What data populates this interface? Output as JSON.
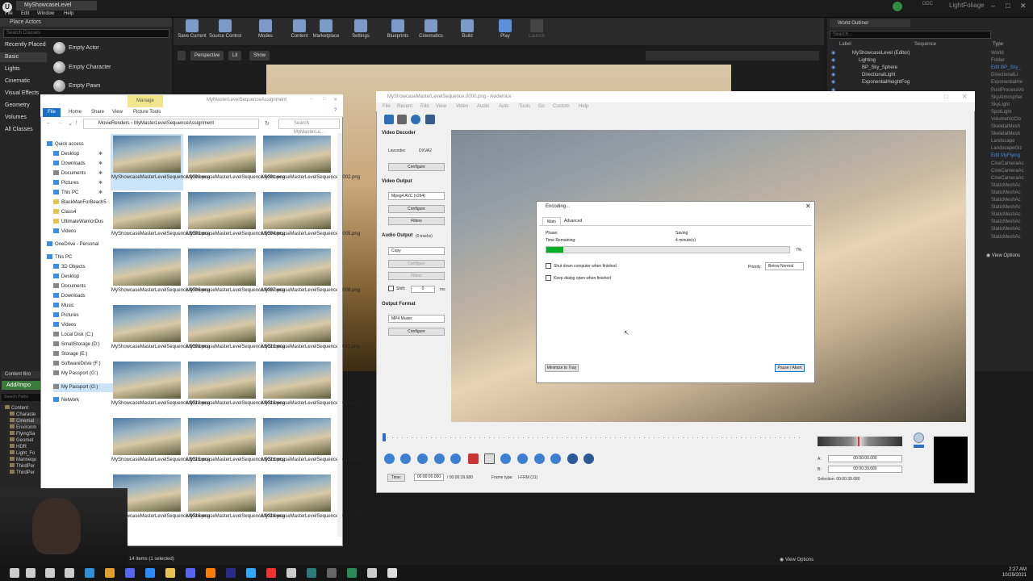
{
  "ue": {
    "tab_title": "MyShowcaseLevel",
    "menus": [
      "File",
      "Edit",
      "Window",
      "Help"
    ],
    "right_title": "LightFoliage",
    "ddc": "DDC",
    "place_actors": {
      "header": "Place Actors",
      "search_placeholder": "Search Classes",
      "categories": [
        "Recently Placed",
        "Basic",
        "Lights",
        "Cinematic",
        "Visual Effects",
        "Geometry",
        "Volumes",
        "All Classes"
      ],
      "active_category": "Basic",
      "items": [
        "Empty Actor",
        "Empty Character",
        "Empty Pawn"
      ]
    },
    "toolbar": [
      "Save Current",
      "Source Control",
      "Modes",
      "Content",
      "Marketplace",
      "Settings",
      "Blueprints",
      "Cinematics",
      "Build",
      "Play",
      "Launch"
    ],
    "viewport": {
      "perspective": "Perspective",
      "lit": "Lit",
      "show": "Show"
    },
    "outliner": {
      "tab": "World Outliner",
      "search_placeholder": "Search...",
      "col_label": "Label",
      "col_sequence": "Sequence",
      "col_type": "Type",
      "rows": [
        {
          "label": "MyShowcaseLevel (Editor)",
          "type": "World",
          "link": false
        },
        {
          "label": "Lighting",
          "type": "Folder",
          "link": false
        },
        {
          "label": "BP_Sky_Sphere",
          "type": "Edit BP_Sky_",
          "link": true
        },
        {
          "label": "DirectionalLight",
          "type": "DirectionalLi",
          "link": false
        },
        {
          "label": "ExponentialHeightFog",
          "type": "ExponentialHe",
          "link": false
        },
        {
          "label": "",
          "type": "PostProcessVo",
          "link": false
        },
        {
          "label": "",
          "type": "SkyAtmospher",
          "link": false
        },
        {
          "label": "",
          "type": "SkyLight",
          "link": false
        },
        {
          "label": "",
          "type": "SpotLight",
          "link": false
        },
        {
          "label": "",
          "type": "VolumetricClo",
          "link": false
        },
        {
          "label": "",
          "type": "SkeletalMesh",
          "link": false
        },
        {
          "label": "",
          "type": "SkeletalMesh",
          "link": false
        },
        {
          "label": "",
          "type": "Landscape",
          "link": false
        },
        {
          "label": "",
          "type": "LandscapeGiz",
          "link": false
        },
        {
          "label": "",
          "type": "Edit MyFlying",
          "link": true
        },
        {
          "label": "",
          "type": "CineCameraAc",
          "link": false
        },
        {
          "label": "",
          "type": "CineCameraAc",
          "link": false
        },
        {
          "label": "",
          "type": "CineCameraAc",
          "link": false
        },
        {
          "label": "",
          "type": "StaticMeshAc",
          "link": false
        },
        {
          "label": "",
          "type": "StaticMeshAc",
          "link": false
        },
        {
          "label": "",
          "type": "StaticMeshAc",
          "link": false
        },
        {
          "label": "",
          "type": "StaticMeshAc",
          "link": false
        },
        {
          "label": "",
          "type": "StaticMeshAc",
          "link": false
        },
        {
          "label": "",
          "type": "StaticMeshAc",
          "link": false
        },
        {
          "label": "",
          "type": "StaticMeshAc",
          "link": false
        },
        {
          "label": "",
          "type": "StaticMeshAc",
          "link": false
        }
      ],
      "view_options": "View Options"
    },
    "content_browser": {
      "tab": "Content Bro",
      "add_import": "Add/Impo",
      "search": "Search Paths",
      "tree": [
        "Content",
        "Characte",
        "Cinemat",
        "Environm",
        "FlyingSa",
        "Geomet",
        "HDR",
        "Light_Fo",
        "Mannequ",
        "ThirdPer",
        "ThirdPer"
      ]
    },
    "view_options_bottom": "View Options"
  },
  "explorer": {
    "title": "MyMasterLevelSequenceAssignment",
    "manage": "Manage",
    "ribbon": [
      "File",
      "Home",
      "Share",
      "View",
      "Picture Tools"
    ],
    "path": [
      "MovieRenders",
      "MyMasterLevelSequenceAssignment"
    ],
    "search_placeholder": "Search MyMasterLe...",
    "nav": [
      {
        "label": "Quick access",
        "icon": "b",
        "pin": false
      },
      {
        "label": "Desktop",
        "icon": "b",
        "pin": true
      },
      {
        "label": "Downloads",
        "icon": "b",
        "pin": true
      },
      {
        "label": "Documents",
        "icon": "g",
        "pin": true
      },
      {
        "label": "Pictures",
        "icon": "b",
        "pin": true
      },
      {
        "label": "This PC",
        "icon": "b",
        "pin": true
      },
      {
        "label": "BlackManForBeach5",
        "icon": "y",
        "pin": false
      },
      {
        "label": "Class4",
        "icon": "y",
        "pin": false
      },
      {
        "label": "UltimateWarriorDus",
        "icon": "y",
        "pin": false
      },
      {
        "label": "Videos",
        "icon": "b",
        "pin": false
      },
      {
        "label": "OneDrive - Personal",
        "icon": "b",
        "pin": false
      },
      {
        "label": "This PC",
        "icon": "b",
        "pin": false
      },
      {
        "label": "3D Objects",
        "icon": "b",
        "pin": false
      },
      {
        "label": "Desktop",
        "icon": "b",
        "pin": false
      },
      {
        "label": "Documents",
        "icon": "g",
        "pin": false
      },
      {
        "label": "Downloads",
        "icon": "b",
        "pin": false
      },
      {
        "label": "Music",
        "icon": "b",
        "pin": false
      },
      {
        "label": "Pictures",
        "icon": "b",
        "pin": false
      },
      {
        "label": "Videos",
        "icon": "b",
        "pin": false
      },
      {
        "label": "Local Disk (C:)",
        "icon": "g",
        "pin": false
      },
      {
        "label": "SmallStorage (D:)",
        "icon": "g",
        "pin": false
      },
      {
        "label": "Storage (E:)",
        "icon": "g",
        "pin": false
      },
      {
        "label": "SoftwareDrive (F:)",
        "icon": "g",
        "pin": false
      },
      {
        "label": "My Passport (G:)",
        "icon": "g",
        "pin": false
      },
      {
        "label": "My Passport (G:)",
        "icon": "g",
        "pin": false,
        "selected": true
      },
      {
        "label": "Network",
        "icon": "b",
        "pin": false
      }
    ],
    "files": [
      "MyShowcaseMasterLevelSequence.0000.png",
      "MyShowcaseMasterLevelSequence.0001.png",
      "MyShowcaseMasterLevelSequence.0002.png",
      "MyShowcaseMasterLevelSequence.0003.png",
      "MyShowcaseMasterLevelSequence.0004.png",
      "MyShowcaseMasterLevelSequence.0005.png",
      "MyShowcaseMasterLevelSequence.0006.png",
      "MyShowcaseMasterLevelSequence.0007.png",
      "MyShowcaseMasterLevelSequence.0008.png",
      "MyShowcaseMasterLevelSequence.0009.png",
      "MyShowcaseMasterLevelSequence.0010.png",
      "MyShowcaseMasterLevelSequence.0011.png",
      "MyShowcaseMasterLevelSequence.0012.png",
      "MyShowcaseMasterLevelSequence.0013.png",
      "MyShowcaseMasterLevelSequence.0014.png",
      "MyShowcaseMasterLevelSequence.0015.png",
      "MyShowcaseMasterLevelSequence.0016.png",
      "MyShowcaseMasterLevelSequence.0017.png",
      "MyShowcaseMasterLevelSequence.0018.png",
      "MyShowcaseMasterLevelSequence.0019.png",
      "MyShowcaseMasterLevelSequence.0020.png"
    ],
    "status": "14 items (1 selected)"
  },
  "avidemux": {
    "title": "MyShowcaseMasterLevelSequence.0000.png - Avidemux",
    "menus": [
      "File",
      "Recent",
      "Edit",
      "View",
      "Video",
      "Audio",
      "Auto",
      "Tools",
      "Go",
      "Custom",
      "Help"
    ],
    "video_decoder": "Video Decoder",
    "lavcodec": "Lavcodec",
    "dxva2": "DXVA2",
    "configure": "Configure",
    "video_output": "Video Output",
    "video_codec": "Mpeg4 AVC (x264)",
    "filters": "Filters",
    "audio_output": "Audio Output",
    "tracks": "(0 tracks)",
    "audio_codec": "Copy",
    "shift": "Shift:",
    "shift_val": "0",
    "ms": "ms",
    "output_format": "Output Format",
    "muxer": "MP4 Muxer",
    "time_label": "Time:",
    "time_cur": "00:00:00.000",
    "time_total": "/ 00:00:39.680",
    "frame_type": "Frame type:",
    "frame_val": "I-FRM (31)",
    "a_label": "A:",
    "a_val": "00:00:00.000",
    "b_label": "B:",
    "b_val": "00:00:39.680",
    "selection": "Selection: 00:00:39.680"
  },
  "dialog": {
    "title": "Encoding...",
    "tabs": [
      "Main",
      "Advanced"
    ],
    "phase_label": "Phase:",
    "phase_val": "Saving",
    "remaining_label": "Time Remaining:",
    "remaining_val": "4 minute(s)",
    "progress": 7,
    "progress_text": "7%",
    "shutdown": "Shut down computer when finished",
    "keep_open": "Keep dialog open when finished",
    "priority_label": "Priority:",
    "priority_val": "Below Normal",
    "minimize": "Minimize to Tray",
    "pause": "Pause / Abort"
  },
  "taskbar": {
    "time": "2:27 AM",
    "date": "10/29/2021"
  },
  "colors": {
    "ue_bg": "#262626",
    "progress": "#06b025",
    "accent": "#1a73c9",
    "avid_ctrl": "#3d7fd1"
  }
}
